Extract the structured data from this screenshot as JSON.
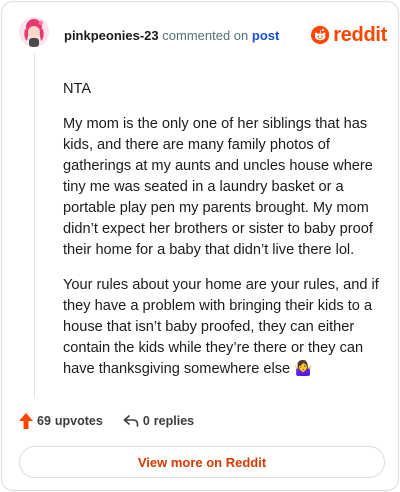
{
  "header": {
    "username": "pinkpeonies-23",
    "commented_text": "commented on",
    "post_link": "post",
    "brand": "reddit"
  },
  "comment": {
    "paragraphs": [
      "NTA",
      "My mom is the only one of her siblings that has kids, and there are many family photos of gatherings at my aunts and uncles house where tiny me was seated in a laundry basket or a portable play pen my parents brought. My mom didn’t expect her brothers or sister to baby proof their home for a baby that didn’t live there lol.",
      "Your rules about your home are your rules, and if they have a problem with bringing their kids to a house that isn’t baby proofed, they can either contain the kids while they’re there or they can have thanksgiving somewhere else 🤷‍♀️"
    ]
  },
  "actions": {
    "upvote_count": "69",
    "upvote_unit": "upvotes",
    "reply_count": "0",
    "reply_unit": "replies"
  },
  "view_more_label": "View more on Reddit",
  "colors": {
    "brand": "#ff4500",
    "link": "#1a4fd6",
    "view_more": "#d93a00"
  },
  "icons": {
    "upvote": "upvote-arrow-icon",
    "reply": "reply-arrow-icon",
    "brand": "reddit-snoo-icon"
  }
}
